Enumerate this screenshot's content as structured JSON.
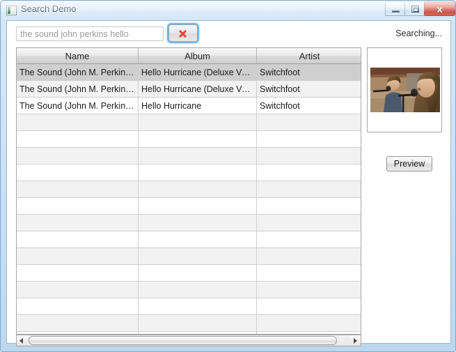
{
  "window": {
    "title": "Search Demo",
    "icon": "app-window-icon",
    "controls": {
      "minimize": "–",
      "maximize": "□",
      "close": "x"
    }
  },
  "toolbar": {
    "search_value": "the sound john perkins hello",
    "search_placeholder": "the sound john perkins hello",
    "clear_button_label": "",
    "clear_button_icon": "red-x-icon",
    "status": "Searching..."
  },
  "table": {
    "columns": [
      "Name",
      "Album",
      "Artist"
    ],
    "rows": [
      {
        "name": "The Sound (John M. Perkins ...",
        "album": "Hello Hurricane (Deluxe Versi...",
        "artist": "Switchfoot",
        "state": "selected"
      },
      {
        "name": "The Sound (John M. Perkins' ...",
        "album": "Hello Hurricane (Deluxe Versi...",
        "artist": "Switchfoot",
        "state": "alt"
      },
      {
        "name": "The Sound (John M. Perkins' ...",
        "album": "Hello Hurricane",
        "artist": "Switchfoot",
        "state": "white"
      }
    ],
    "empty_row_count": 14
  },
  "scrollbar": {
    "left_arrow": "scroll-left-icon",
    "right_arrow": "scroll-right-icon"
  },
  "preview": {
    "image_alt": "album-artwork-two-singers-at-microphones",
    "button_label": "Preview"
  },
  "colors": {
    "accent": "#79b8e8",
    "clear_icon": "#e8453c",
    "selected_row": "#cfcfcf",
    "alt_row": "#f2f2f2",
    "close_button": "#c0392b"
  }
}
